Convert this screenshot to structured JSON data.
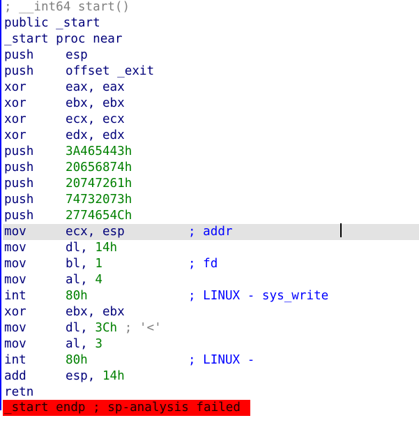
{
  "header_comment": "; __int64 start()",
  "public_decl": "public _start",
  "proc_decl": "_start proc near",
  "instructions": [
    {
      "mn": "push",
      "op": "esp",
      "comment": ""
    },
    {
      "mn": "push",
      "op": "offset _exit",
      "comment": ""
    },
    {
      "mn": "xor",
      "op": "eax, eax",
      "comment": ""
    },
    {
      "mn": "xor",
      "op": "ebx, ebx",
      "comment": ""
    },
    {
      "mn": "xor",
      "op": "ecx, ecx",
      "comment": ""
    },
    {
      "mn": "xor",
      "op": "edx, edx",
      "comment": ""
    },
    {
      "mn": "push",
      "op_num": "3A465443h",
      "comment": ""
    },
    {
      "mn": "push",
      "op_num": "20656874h",
      "comment": ""
    },
    {
      "mn": "push",
      "op_num": "20747261h",
      "comment": ""
    },
    {
      "mn": "push",
      "op_num": "74732073h",
      "comment": ""
    },
    {
      "mn": "push",
      "op_num": "2774654Ch",
      "comment": ""
    },
    {
      "mn": "mov",
      "op": "ecx, esp",
      "comment": "; addr"
    },
    {
      "mn": "mov",
      "op_pre": "dl, ",
      "op_num": "14h",
      "comment": ""
    },
    {
      "mn": "mov",
      "op_pre": "bl, ",
      "op_num": "1",
      "comment": "; fd"
    },
    {
      "mn": "mov",
      "op_pre": "al, ",
      "op_num": "4",
      "comment": ""
    },
    {
      "mn": "int",
      "op_num": "80h",
      "comment": "; LINUX - sys_write"
    },
    {
      "mn": "xor",
      "op": "ebx, ebx",
      "comment": ""
    },
    {
      "mn": "mov",
      "op_pre": "dl, ",
      "op_num": "3Ch",
      "op_post": " ; '<'",
      "comment": ""
    },
    {
      "mn": "mov",
      "op_pre": "al, ",
      "op_num": "3",
      "comment": ""
    },
    {
      "mn": "int",
      "op_num": "80h",
      "comment": "; LINUX -"
    },
    {
      "mn": "add",
      "op_pre": "esp, ",
      "op_num": "14h",
      "comment": ""
    },
    {
      "mn": "retn",
      "op": "",
      "comment": ""
    }
  ],
  "error_line": "_start endp ; sp-analysis failed",
  "colors": {
    "mnemonic": "#00007a",
    "number": "#008000",
    "comment": "#0000ff",
    "highlight": "#e3e3e3",
    "error_bg": "#ff0000"
  }
}
